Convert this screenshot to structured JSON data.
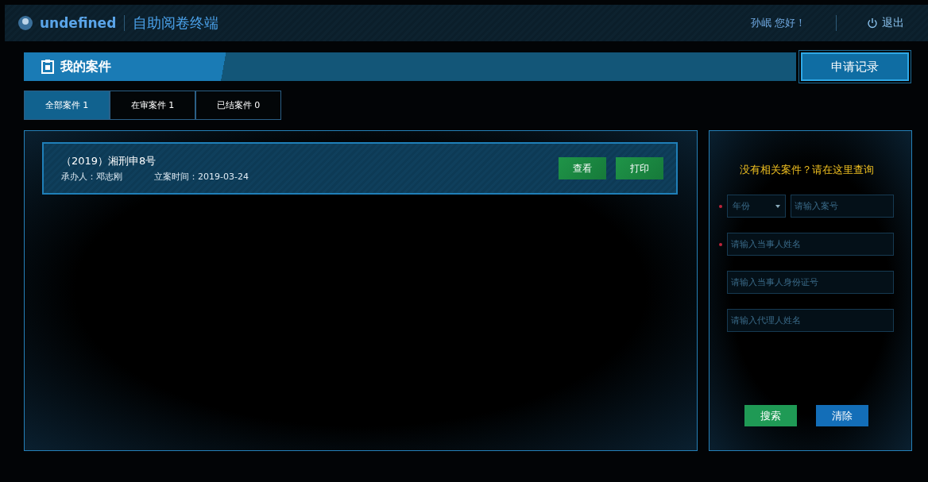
{
  "header": {
    "brand": "undefined",
    "app_title": "自助阅卷终端",
    "greeting": "孙岷 您好！",
    "logout": "退出"
  },
  "section": {
    "title": "我的案件",
    "action": "申请记录"
  },
  "tabs": [
    {
      "label": "全部案件 1",
      "selected": true
    },
    {
      "label": "在审案件 1",
      "selected": false
    },
    {
      "label": "已结案件 0",
      "selected": false
    }
  ],
  "cases": [
    {
      "title": "（2019）湘刑申8号",
      "handler": "承办人：邓志刚",
      "filed": "立案时间：2019-03-24",
      "actions": [
        "查看",
        "打印"
      ]
    }
  ],
  "search_panel": {
    "title": "没有相关案件？请在这里查询",
    "rows": [
      {
        "required": true,
        "fields": [
          {
            "kind": "select",
            "value": "年份"
          },
          {
            "kind": "input",
            "placeholder": "请输入案号"
          }
        ]
      },
      {
        "required": true,
        "fields": [
          {
            "kind": "input",
            "placeholder": "请输入当事人姓名"
          }
        ]
      },
      {
        "required": false,
        "fields": [
          {
            "kind": "input",
            "placeholder": "请输入当事人身份证号"
          }
        ]
      },
      {
        "required": false,
        "fields": [
          {
            "kind": "input",
            "placeholder": "请输入代理人姓名"
          }
        ]
      }
    ],
    "buttons": [
      {
        "label": "搜索",
        "kind": "primary"
      },
      {
        "label": "清除",
        "kind": "secondary"
      }
    ]
  }
}
